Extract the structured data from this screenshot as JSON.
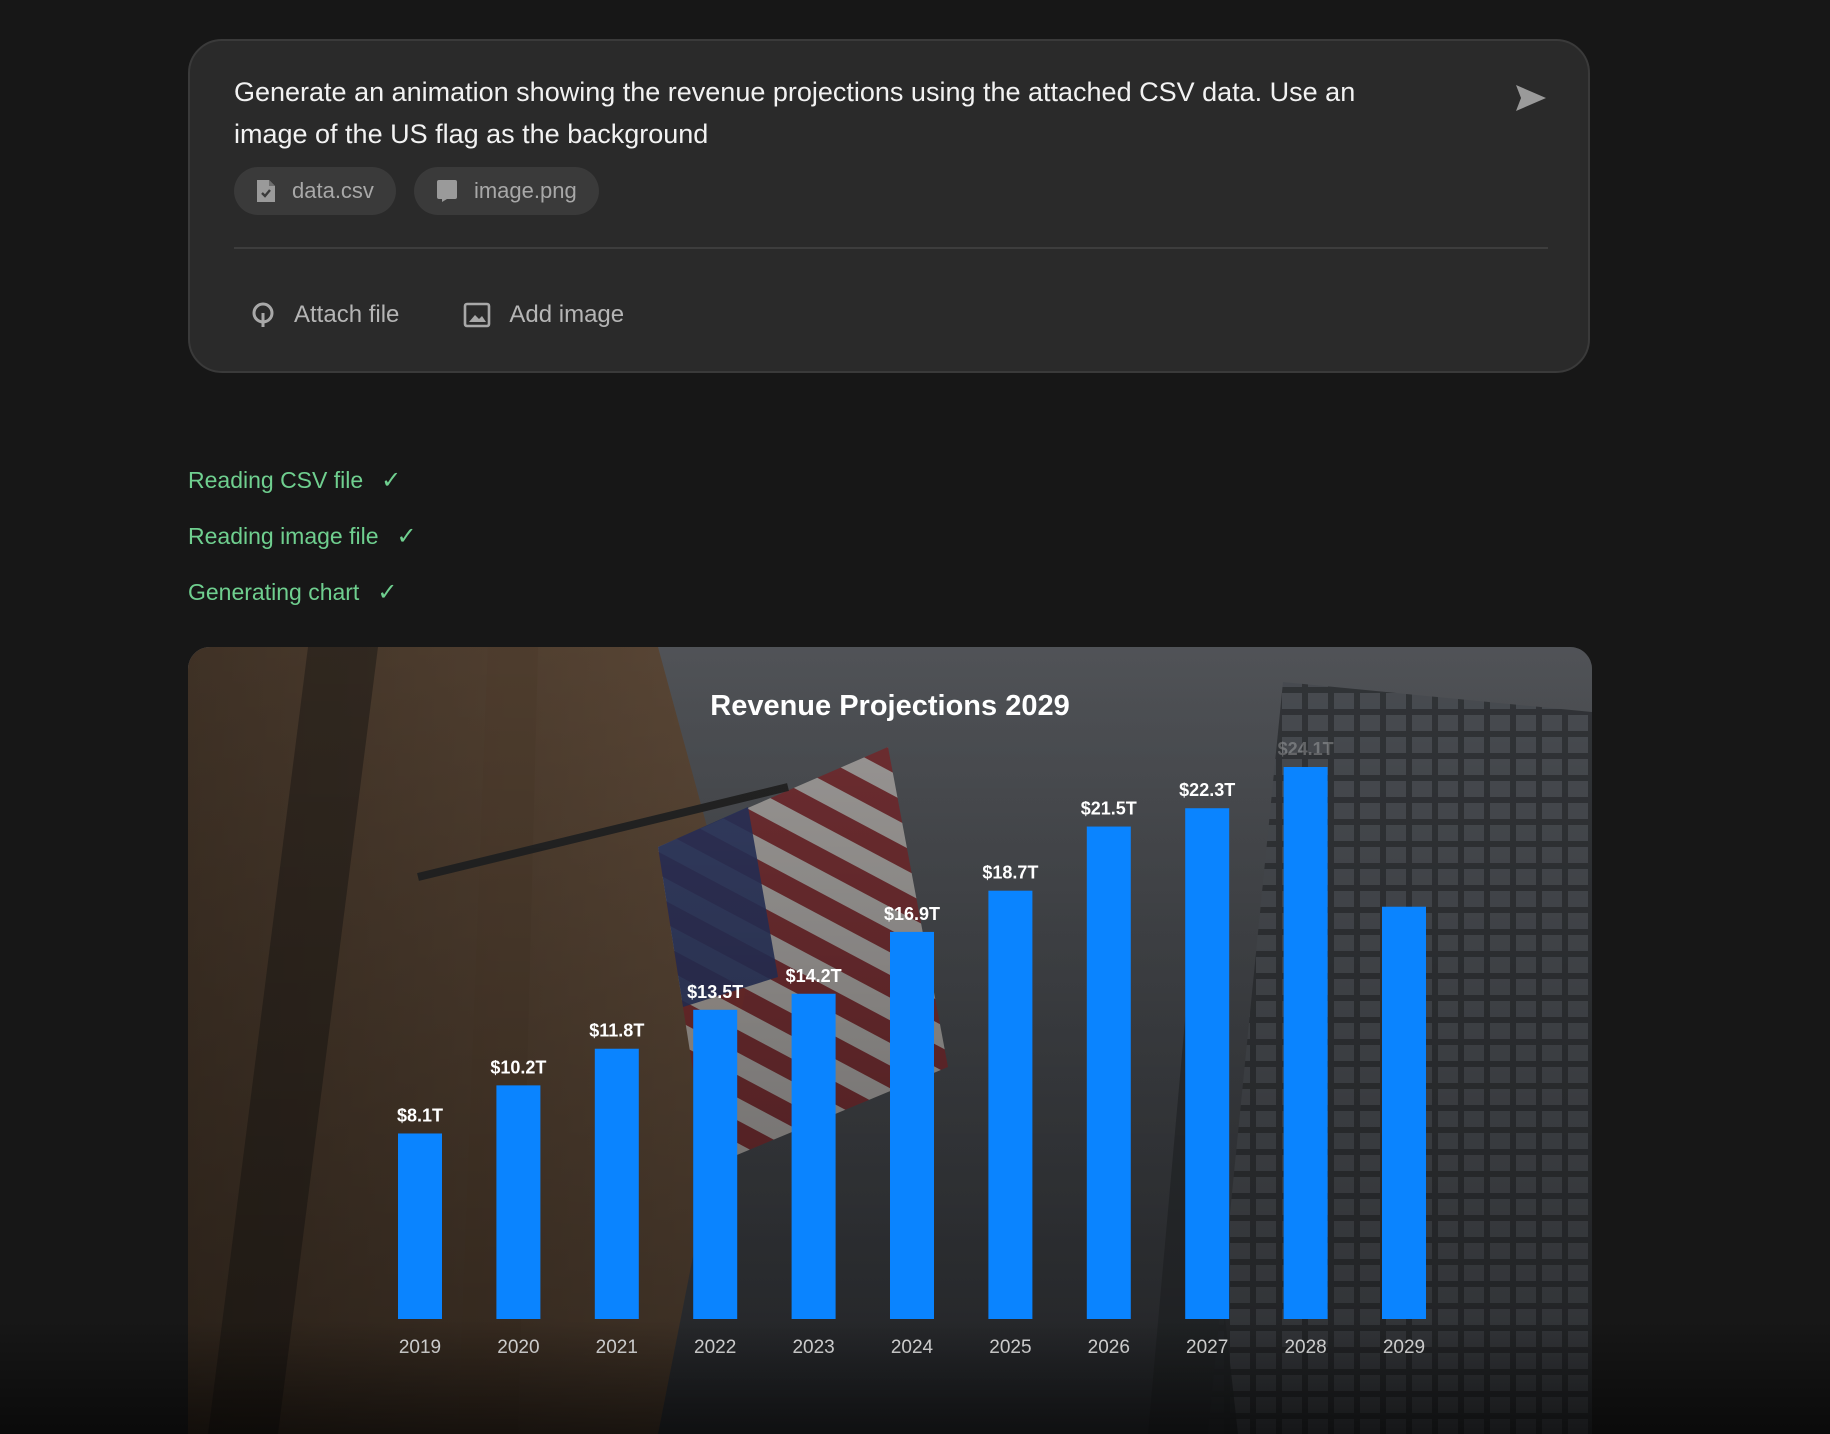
{
  "prompt": {
    "text": "Generate an animation showing the revenue projections using the attached CSV data. Use an image of the US flag as the background",
    "send_icon": "send-icon",
    "attachments": [
      {
        "name": "data.csv",
        "icon": "file-icon"
      },
      {
        "name": "image.png",
        "icon": "image-file-icon"
      }
    ],
    "actions": {
      "attach_label": "Attach file",
      "attach_icon": "paperclip-icon",
      "image_label": "Add image",
      "image_icon": "image-icon"
    }
  },
  "status": [
    {
      "label": "Reading CSV file",
      "icon": "check-icon"
    },
    {
      "label": "Reading image file",
      "icon": "check-icon"
    },
    {
      "label": "Generating chart",
      "icon": "check-icon"
    }
  ],
  "colors": {
    "accent_green": "#6fcf8f",
    "bar_blue": "#0a84ff"
  },
  "chart_data": {
    "type": "bar",
    "title": "Revenue Projections 2029",
    "categories": [
      "2019",
      "2020",
      "2021",
      "2022",
      "2023",
      "2024",
      "2025",
      "2026",
      "2027",
      "2028",
      "2029"
    ],
    "values": [
      8.1,
      10.2,
      11.8,
      13.5,
      14.2,
      16.9,
      18.7,
      21.5,
      22.3,
      24.1,
      18.0
    ],
    "value_labels": [
      "$8.1T",
      "$10.2T",
      "$11.8T",
      "$13.5T",
      "$14.2T",
      "$16.9T",
      "$18.7T",
      "$21.5T",
      "$22.3T",
      "$24.1T",
      ""
    ],
    "xlabel": "",
    "ylabel": "",
    "ylim": [
      0,
      24.1
    ],
    "grid": false,
    "background": "photo of US flag on building facade"
  }
}
